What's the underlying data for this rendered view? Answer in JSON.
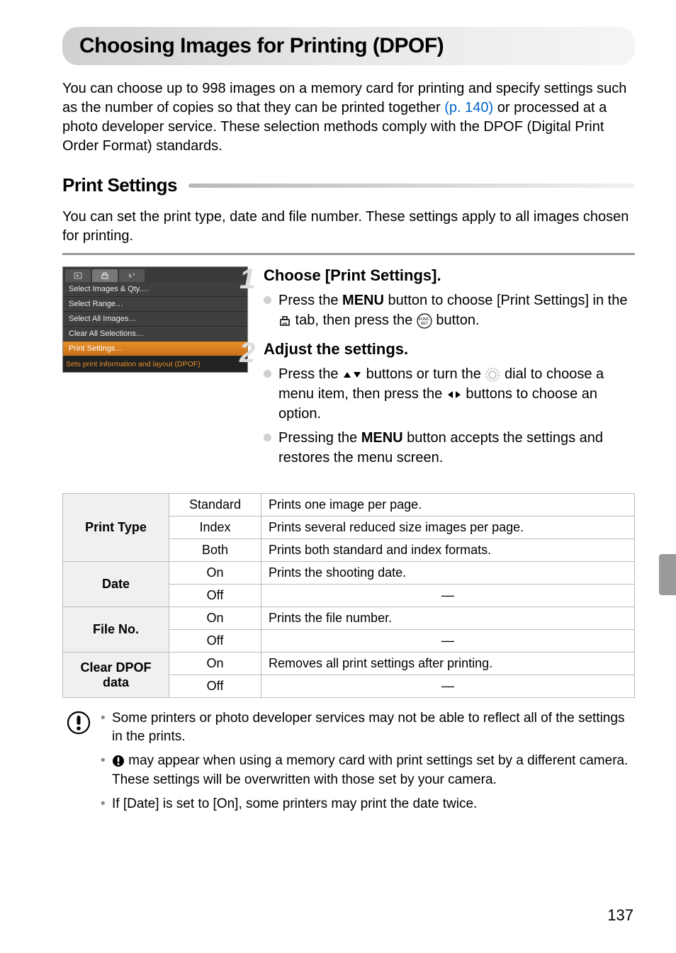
{
  "page": {
    "title": "Choosing Images for Printing (DPOF)",
    "intro_a": "You can choose up to 998 images on a memory card for printing and specify settings such as the number of copies so that they can be printed together ",
    "intro_link": "(p. 140)",
    "intro_b": " or processed at a photo developer service. These selection methods comply with the DPOF (Digital Print Order Format) standards.",
    "page_number": "137"
  },
  "section": {
    "heading": "Print Settings",
    "intro": "You can set the print type, date and file number. These settings apply to all images chosen for printing."
  },
  "screenshot": {
    "rows": [
      "Select Images & Qty.…",
      "Select Range…",
      "Select All Images…",
      "Clear All Selections…",
      "Print Settings…"
    ],
    "footer": "Sets print information and layout (DPOF)"
  },
  "steps": {
    "s1": {
      "num": "1",
      "title": "Choose [Print Settings].",
      "b1a": "Press the ",
      "menu": "MENU",
      "b1b": " button to choose [Print Settings] in the ",
      "b1c": " tab, then press the ",
      "b1d": " button."
    },
    "s2": {
      "num": "2",
      "title": "Adjust the settings.",
      "b1a": "Press the ",
      "b1b": " buttons or turn the ",
      "b1c": " dial to choose a menu item, then press the ",
      "b1d": " buttons to choose an option.",
      "b2a": "Pressing the ",
      "b2b": " button accepts the settings and restores the menu screen."
    }
  },
  "table": {
    "rows": [
      {
        "head": "Print Type",
        "opts": [
          {
            "opt": "Standard",
            "desc": "Prints one image per page."
          },
          {
            "opt": "Index",
            "desc": "Prints several reduced size images per page."
          },
          {
            "opt": "Both",
            "desc": "Prints both standard and index formats."
          }
        ]
      },
      {
        "head": "Date",
        "opts": [
          {
            "opt": "On",
            "desc": "Prints the shooting date."
          },
          {
            "opt": "Off",
            "desc": "—"
          }
        ]
      },
      {
        "head": "File No.",
        "opts": [
          {
            "opt": "On",
            "desc": "Prints the file number."
          },
          {
            "opt": "Off",
            "desc": "—"
          }
        ]
      },
      {
        "head": "Clear DPOF data",
        "opts": [
          {
            "opt": "On",
            "desc": "Removes all print settings after printing."
          },
          {
            "opt": "Off",
            "desc": "—"
          }
        ]
      }
    ]
  },
  "caution": {
    "items": [
      {
        "a": "Some printers or photo developer services may not be able to reflect all of the settings in the prints."
      },
      {
        "icon": true,
        "a": " may appear when using a memory card with print settings set by a different camera. These settings will be overwritten with those set by your camera."
      },
      {
        "a": "If [Date] is set to [On], some printers may print the date twice."
      }
    ]
  }
}
